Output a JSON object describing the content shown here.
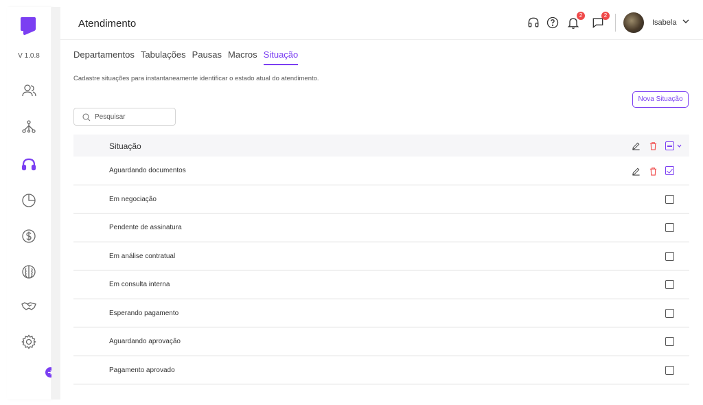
{
  "app": {
    "version": "V 1.0.8",
    "accent": "#7b3ff2"
  },
  "header": {
    "title": "Atendimento",
    "user_name": "Isabela",
    "notifications_badge": "2",
    "messages_badge": "2"
  },
  "sidebar": {
    "items": [
      {
        "name": "contacts",
        "icon": "users-icon"
      },
      {
        "name": "network",
        "icon": "network-icon"
      },
      {
        "name": "support",
        "icon": "headset-icon",
        "active": true
      },
      {
        "name": "reports",
        "icon": "pie-chart-icon"
      },
      {
        "name": "finance",
        "icon": "dollar-icon"
      },
      {
        "name": "ai",
        "icon": "brain-icon"
      },
      {
        "name": "deals",
        "icon": "handshake-icon"
      },
      {
        "name": "settings",
        "icon": "gear-icon"
      }
    ]
  },
  "tabs": [
    {
      "label": "Departamentos"
    },
    {
      "label": "Tabulações"
    },
    {
      "label": "Pausas"
    },
    {
      "label": "Macros"
    },
    {
      "label": "Situação",
      "active": true
    }
  ],
  "description": "Cadastre situações para instantaneamente identificar o estado atual do atendimento.",
  "new_button": "Nova Situação",
  "search": {
    "placeholder": "Pesquisar"
  },
  "table": {
    "header": "Situação",
    "rows": [
      {
        "label": "Aguardando documentos",
        "checked": true
      },
      {
        "label": "Em negociação",
        "checked": false
      },
      {
        "label": "Pendente de assinatura",
        "checked": false
      },
      {
        "label": "Em análise contratual",
        "checked": false
      },
      {
        "label": "Em consulta interna",
        "checked": false
      },
      {
        "label": "Esperando pagamento",
        "checked": false
      },
      {
        "label": "Aguardando aprovação",
        "checked": false
      },
      {
        "label": "Pagamento aprovado",
        "checked": false
      }
    ]
  }
}
